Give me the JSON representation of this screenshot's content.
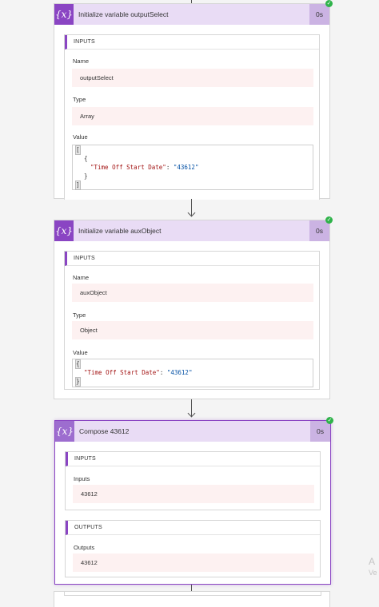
{
  "cards": [
    {
      "title": "Initialize variable outputSelect",
      "duration": "0s",
      "icon": "variable-icon",
      "icon_text": "{x}",
      "inputs_label": "INPUTS",
      "fields": {
        "name_label": "Name",
        "name_value": "outputSelect",
        "type_label": "Type",
        "type_value": "Array",
        "value_label": "Value"
      },
      "code": {
        "l1": "[",
        "l2": "{",
        "l3_key": "\"Time Off Start Date\"",
        "l3_sep": ": ",
        "l3_val": "\"43612\"",
        "l4": "}",
        "l5": "]"
      }
    },
    {
      "title": "Initialize variable auxObject",
      "duration": "0s",
      "icon": "variable-icon",
      "icon_text": "{x}",
      "inputs_label": "INPUTS",
      "fields": {
        "name_label": "Name",
        "name_value": "auxObject",
        "type_label": "Type",
        "type_value": "Object",
        "value_label": "Value"
      },
      "code": {
        "l1": "{",
        "l2_key": "\"Time Off Start Date\"",
        "l2_sep": ": ",
        "l2_val": "\"43612\"",
        "l3": "}"
      }
    },
    {
      "title": "Compose 43612",
      "duration": "0s",
      "icon": "compose-icon",
      "icon_text": "{x}",
      "inputs_label": "INPUTS",
      "inputs_field_label": "Inputs",
      "inputs_value": "43612",
      "outputs_label": "OUTPUTS",
      "outputs_field_label": "Outputs",
      "outputs_value": "43612"
    }
  ],
  "status": "succeeded",
  "watermark": {
    "line1": "A",
    "line2": "Ve"
  },
  "colors": {
    "accent": "#8a45c3",
    "header_bg": "#e9dcf5",
    "success": "#2fb34a",
    "value_bg": "#fdf1f1"
  }
}
